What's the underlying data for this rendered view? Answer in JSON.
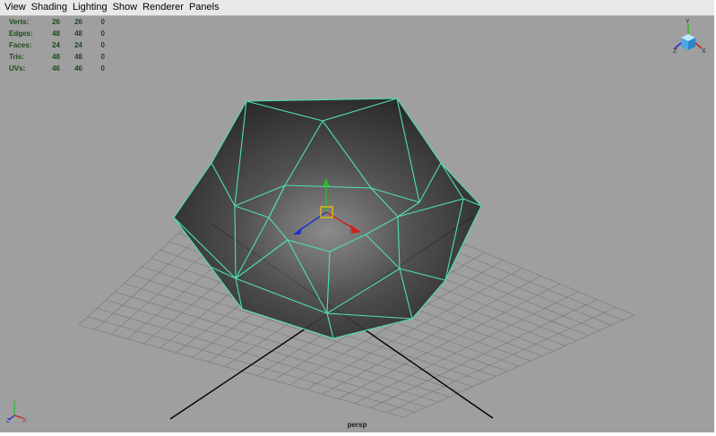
{
  "menu": {
    "items": [
      "View",
      "Shading",
      "Lighting",
      "Show",
      "Renderer",
      "Panels"
    ]
  },
  "hud": {
    "rows": [
      {
        "label": "Verts:",
        "values": [
          "26",
          "26",
          "0"
        ]
      },
      {
        "label": "Edges:",
        "values": [
          "48",
          "48",
          "0"
        ]
      },
      {
        "label": "Faces:",
        "values": [
          "24",
          "24",
          "0"
        ]
      },
      {
        "label": "Tris:",
        "values": [
          "48",
          "48",
          "0"
        ]
      },
      {
        "label": "UVs:",
        "values": [
          "46",
          "46",
          "0"
        ]
      }
    ]
  },
  "viewport": {
    "camera": "persp",
    "background_color": "#9f9f9f",
    "wireframe_color": "#4fe0b0",
    "grid_color": "#7a7a7a"
  },
  "view_cube": {
    "axis_labels": {
      "y": "Y",
      "x": "X",
      "z": "Z"
    }
  },
  "axis_indicator": {
    "labels": {
      "y": "Y",
      "x": "X",
      "z": "Z"
    }
  }
}
